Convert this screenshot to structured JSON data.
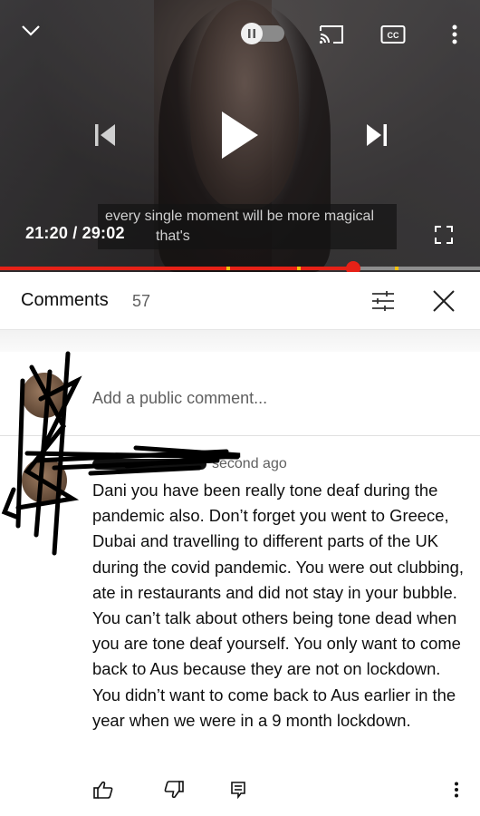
{
  "player": {
    "caption_line1": "every single moment will be more magical",
    "caption_line2": "that's",
    "current_time": "21:20",
    "duration": "29:02",
    "time_display": "21:20 / 29:02",
    "progress_fraction": 0.735,
    "icons": [
      "chevron-down-icon",
      "pause-toggle-icon",
      "cast-icon",
      "captions-icon",
      "more-vertical-icon",
      "previous-icon",
      "play-icon",
      "next-icon",
      "fullscreen-icon"
    ],
    "colors": {
      "progress": "#e62117",
      "ad_marker": "#f4c20d"
    }
  },
  "comments": {
    "title": "Comments",
    "count": "57",
    "add_placeholder": "Add a public comment...",
    "icons": [
      "sort-filter-icon",
      "close-icon"
    ]
  },
  "comment": {
    "timestamp": "1 second ago",
    "timestamp_visible": "second ago",
    "text": "Dani you have been really tone deaf during the pandemic also. Don’t forget you went to Greece, Dubai and travelling to different parts of the UK during the covid pandemic. You were out clubbing, ate in restaurants and did not stay in your bubble. You can’t talk about others being tone dead when you are tone deaf yourself. You only want to come back to Aus because they are not on lockdown. You didn’t want to come back to Aus earlier in the year when we were in a 9 month lockdown.",
    "actions": [
      "like-icon",
      "dislike-icon",
      "reply-icon",
      "more-vertical-icon"
    ]
  }
}
